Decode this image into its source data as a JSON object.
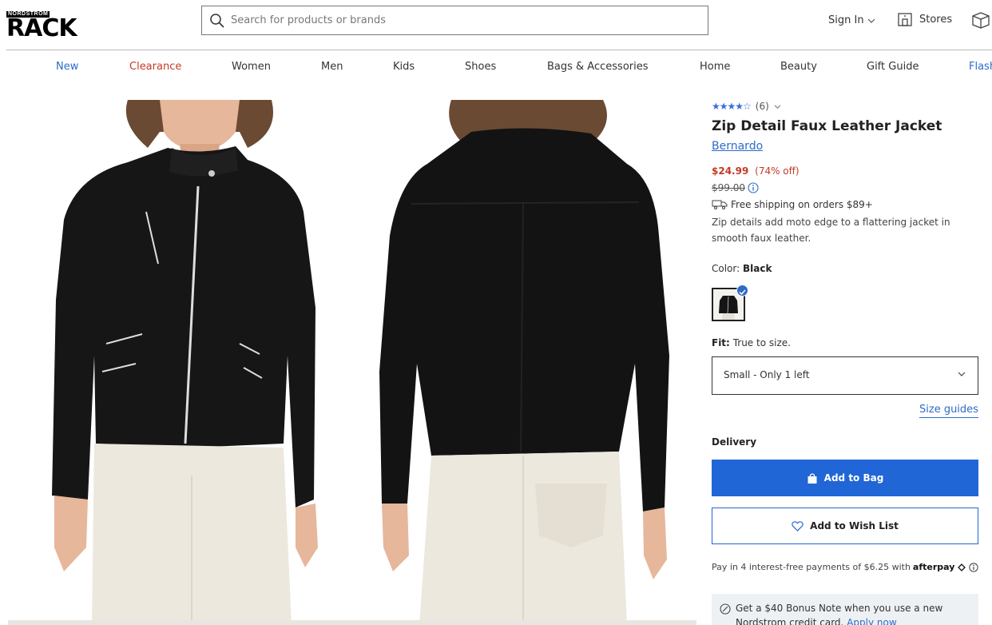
{
  "header": {
    "logo_small": "NORDSTROM",
    "logo_big": "RACK",
    "search_placeholder": "Search for products or brands",
    "signin_label": "Sign In",
    "stores_label": "Stores"
  },
  "nav": [
    {
      "label": "New",
      "color": "#2d6bc8"
    },
    {
      "label": "Clearance",
      "color": "#c43a26"
    },
    {
      "label": "Women",
      "color": "#333333"
    },
    {
      "label": "Men",
      "color": "#333333"
    },
    {
      "label": "Kids",
      "color": "#333333"
    },
    {
      "label": "Shoes",
      "color": "#333333"
    },
    {
      "label": "Bags & Accessories",
      "color": "#333333"
    },
    {
      "label": "Home",
      "color": "#333333"
    },
    {
      "label": "Beauty",
      "color": "#333333"
    },
    {
      "label": "Gift Guide",
      "color": "#333333"
    },
    {
      "label": "Flash",
      "color": "#2d6bc8"
    }
  ],
  "product": {
    "rating_stars": 4.5,
    "review_count": "(6)",
    "title": "Zip Detail Faux Leather Jacket",
    "brand": "Bernardo",
    "price": "$24.99",
    "discount": "(74% off)",
    "original_price": "$99.00",
    "shipping": "Free shipping on orders $89+",
    "description": "Zip details add moto edge to a flattering jacket in smooth faux leather.",
    "color_label": "Color:",
    "color_value": "Black",
    "fit_label": "Fit:",
    "fit_value": "True to size.",
    "size_selected": "Small - Only 1 left",
    "size_guides": "Size guides",
    "delivery_label": "Delivery",
    "add_to_bag": "Add to Bag",
    "add_to_wishlist": "Add to Wish List",
    "afterpay_text": "Pay in 4 interest-free payments of $6.25 with",
    "afterpay_brand": "afterpay",
    "bonus_text": "Get a $40 Bonus Note when you use a new Nordstrom credit card.",
    "bonus_link": "Apply now"
  },
  "colors": {
    "accent_blue": "#2166d6",
    "sale_red": "#c43a26"
  }
}
